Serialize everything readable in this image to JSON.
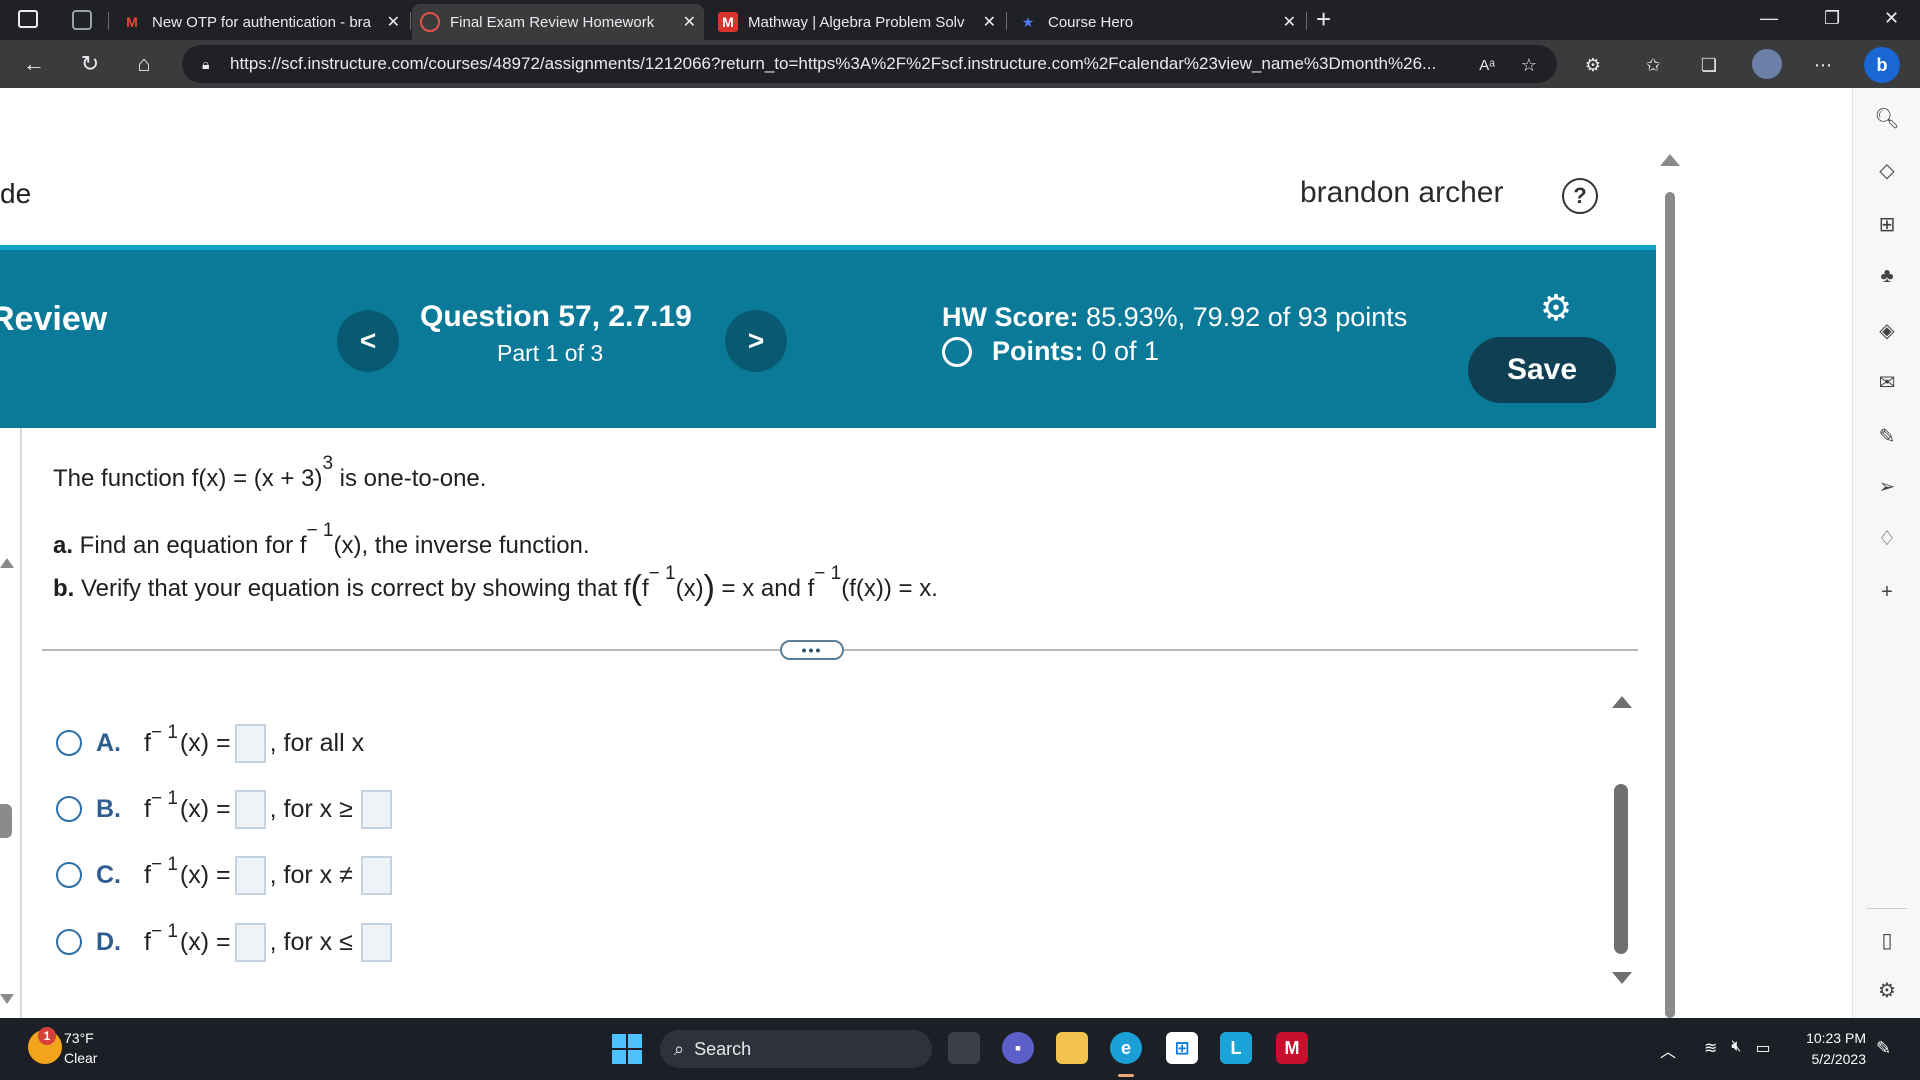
{
  "browser": {
    "tabs": [
      {
        "title": "New OTP for authentication - bra",
        "icon": "gmail-icon"
      },
      {
        "title": "Final Exam Review Homework",
        "icon": "pearson-icon"
      },
      {
        "title": "Mathway | Algebra Problem Solv",
        "icon": "mathway-icon"
      },
      {
        "title": "Course Hero",
        "icon": "coursehero-icon"
      }
    ],
    "url": "https://scf.instructure.com/courses/48972/assignments/1212066?return_to=https%3A%2F%2Fscf.instructure.com%2Fcalendar%23view_name%3Dmonth%26...",
    "reader_label": "Aᵃ"
  },
  "page": {
    "course_fragment": "de",
    "user_name": "brandon archer",
    "section_title": "Review",
    "question_title": "Question 57, 2.7.19",
    "question_part": "Part 1 of 3",
    "hw_score_label": "HW Score:",
    "hw_score_value": "85.93%, 79.92 of 93 points",
    "points_label": "Points:",
    "points_value": "0 of 1",
    "save_label": "Save",
    "prev_label": "<",
    "next_label": ">",
    "more_label": "•••"
  },
  "problem": {
    "intro_a": "The function f(x) = (x + 3)",
    "intro_exp": "3",
    "intro_b": " is one-to-one.",
    "part_a_label": "a.",
    "part_a_text_1": " Find an equation for f",
    "part_a_exp": "− 1",
    "part_a_text_2": "(x), the inverse function.",
    "part_b_label": "b.",
    "part_b_text_1": " Verify that your equation is correct by showing that f",
    "part_b_open": "(",
    "part_b_f": "f",
    "part_b_exp": "− 1",
    "part_b_x": "(x)",
    "part_b_close": ")",
    "part_b_text_2": " = x and f",
    "part_b_exp2": "− 1",
    "part_b_text_3": "(f(x)) = x."
  },
  "choices": [
    {
      "letter": "A.",
      "fn": "f",
      "exp": "− 1",
      "lhs": "(x) =",
      "condition": ", for all x",
      "has_second_box": false
    },
    {
      "letter": "B.",
      "fn": "f",
      "exp": "− 1",
      "lhs": "(x) =",
      "condition": ", for x ≥",
      "has_second_box": true
    },
    {
      "letter": "C.",
      "fn": "f",
      "exp": "− 1",
      "lhs": "(x) =",
      "condition": ", for x ≠",
      "has_second_box": true
    },
    {
      "letter": "D.",
      "fn": "f",
      "exp": "− 1",
      "lhs": "(x) =",
      "condition": ", for x ≤",
      "has_second_box": true
    }
  ],
  "taskbar": {
    "weather_temp": "73°F",
    "weather_condition": "Clear",
    "weather_badge": "1",
    "search_label": "Search",
    "time": "10:23 PM",
    "date": "5/2/2023"
  },
  "colors": {
    "header_band": "#0b7a99",
    "save_button": "#0e3f52",
    "radio": "#2d6fa8",
    "choice_letter": "#2d5e8f"
  }
}
